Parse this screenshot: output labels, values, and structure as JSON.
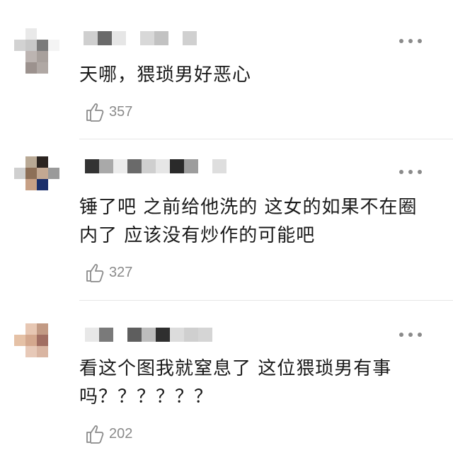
{
  "comments": [
    {
      "text": "天哪，猥琐男好恶心",
      "likes": "357",
      "avatar_colors": [
        "#ffffff",
        "#e9e9e9",
        "#ffffff",
        "#ffffff",
        "#d2d2d2",
        "#c8c8c8",
        "#7a7a7a",
        "#f4f4f4",
        "#ffffff",
        "#bcb4b1",
        "#a8a09c",
        "#ffffff",
        "#ffffff",
        "#9c928e",
        "#b0a8a4",
        "#ffffff"
      ],
      "name_colors": [
        "#cfcfcf",
        "#6a6a6a",
        "#e6e6e6",
        "#ffffff",
        "#d8d8d8",
        "#c2c2c2",
        "#ffffff",
        "#d0d0d0"
      ]
    },
    {
      "text": "锤了吧 之前给他洗的 这女的如果不在圈内了 应该没有炒作的可能吧",
      "likes": "327",
      "avatar_colors": [
        "#ffffff",
        "#b9a995",
        "#2b2420",
        "#ffffff",
        "#cfcfcf",
        "#8d6f57",
        "#c3a892",
        "#9a9a9a",
        "#ffffff",
        "#c7a085",
        "#1b2f6b",
        "#ffffff",
        "#ffffff",
        "#ffffff",
        "#ffffff",
        "#ffffff"
      ],
      "name_colors": [
        "#333333",
        "#a9a9a9",
        "#ececec",
        "#6a6a6a",
        "#cfcfcf",
        "#e6e6e6",
        "#2a2a2a",
        "#9d9d9d",
        "#ffffff",
        "#dedede"
      ]
    },
    {
      "text": "看这个图我就窒息了 这位猥琐男有事吗？？？？？？",
      "likes": "202",
      "avatar_colors": [
        "#ffffff",
        "#e7c7b3",
        "#c29a84",
        "#ffffff",
        "#e5c1a6",
        "#d4a88e",
        "#a16e62",
        "#ffffff",
        "#ffffff",
        "#e7c9b8",
        "#d9b5a2",
        "#ffffff",
        "#ffffff",
        "#ffffff",
        "#ffffff",
        "#ffffff"
      ],
      "name_colors": [
        "#e8e8e8",
        "#7a7a7a",
        "#ffffff",
        "#5e5e5e",
        "#bdbdbd",
        "#2f2f2f",
        "#dcdcdc",
        "#cfcfcf",
        "#d5d5d5"
      ]
    }
  ],
  "icons": {
    "like": "thumbs-up-icon",
    "more": "more-icon"
  },
  "colors": {
    "text": "#1a1a1a",
    "meta": "#8a8a8a",
    "divider": "#e6e6e6"
  }
}
